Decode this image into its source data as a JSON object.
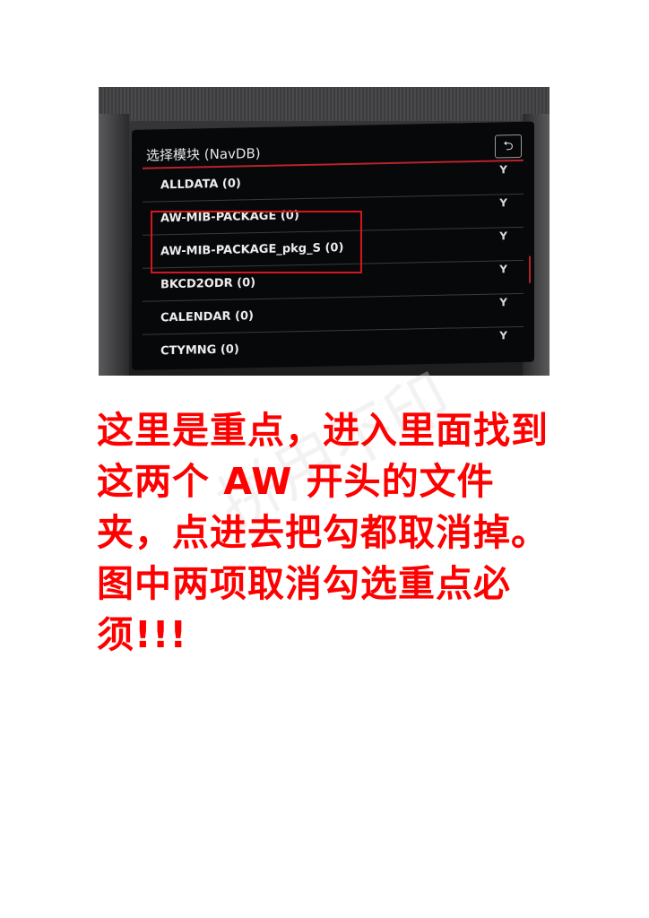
{
  "screen": {
    "title": "选择模块 (NavDB)",
    "back_symbol": "⮌",
    "rows": [
      {
        "label": "ALLDATA (0)",
        "mark": "Y"
      },
      {
        "label": "AW-MIB-PACKAGE (0)",
        "mark": "Y"
      },
      {
        "label": "AW-MIB-PACKAGE_pkg_S (0)",
        "mark": "Y"
      },
      {
        "label": "BKCD2ODR (0)",
        "mark": "Y"
      },
      {
        "label": "CALENDAR (0)",
        "mark": "Y"
      },
      {
        "label": "CTYMNG (0)",
        "mark": "Y"
      }
    ]
  },
  "caption": {
    "text": "这里是重点，进入里面找到这两个 AW 开头的文件夹，点进去把勾都取消掉。图中两项取消勾选重点必须!!!"
  },
  "colors": {
    "accent_red": "#d3171d",
    "caption_red": "#ff0000"
  }
}
